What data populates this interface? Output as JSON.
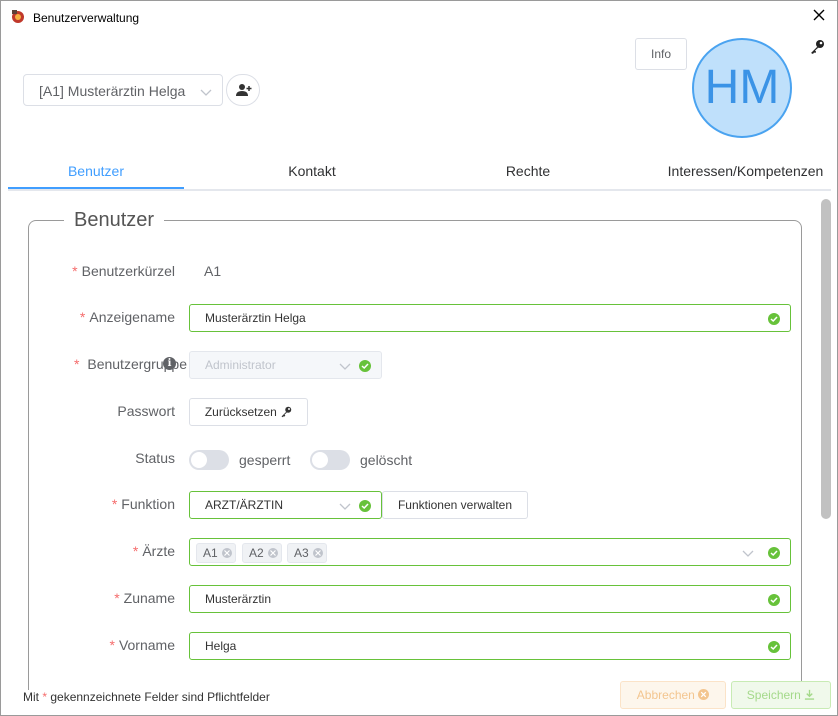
{
  "window": {
    "title": "Benutzerverwaltung",
    "close": "✕"
  },
  "header": {
    "selected_user": "[A1] Musterärztin Helga",
    "info_label": "Info",
    "avatar_initials": "HM"
  },
  "tabs": [
    {
      "label": "Benutzer",
      "active": true
    },
    {
      "label": "Kontakt",
      "active": false
    },
    {
      "label": "Rechte",
      "active": false
    },
    {
      "label": "Interessen/Kompetenzen",
      "active": false
    }
  ],
  "section": {
    "legend": "Benutzer"
  },
  "form": {
    "benutzerkuerzel": {
      "label": "Benutzerkürzel",
      "value": "A1"
    },
    "anzeigename": {
      "label": "Anzeigename",
      "value": "Musterärztin Helga"
    },
    "benutzergruppe": {
      "label": "Benutzergruppe",
      "value": "Administrator"
    },
    "passwort": {
      "label": "Passwort",
      "button": "Zurücksetzen"
    },
    "status": {
      "label": "Status",
      "switch1": "gesperrt",
      "switch2": "gelöscht"
    },
    "funktion": {
      "label": "Funktion",
      "value": "ARZT/ÄRZTIN",
      "button": "Funktionen verwalten"
    },
    "aerzte": {
      "label": "Ärzte",
      "tags": [
        "A1",
        "A2",
        "A3"
      ]
    },
    "zuname": {
      "label": "Zuname",
      "value": "Musterärztin"
    },
    "vorname": {
      "label": "Vorname",
      "value": "Helga"
    }
  },
  "footer": {
    "note_prefix": "Mit",
    "note_star": "*",
    "note_suffix": "gekennzeichnete Felder sind Pflichtfelder",
    "cancel_label": "Abbrechen",
    "save_label": "Speichern"
  },
  "colors": {
    "accent": "#409eff",
    "success": "#67c23a",
    "required": "#f56c6c",
    "avatar_bg": "#bfe0fb"
  }
}
